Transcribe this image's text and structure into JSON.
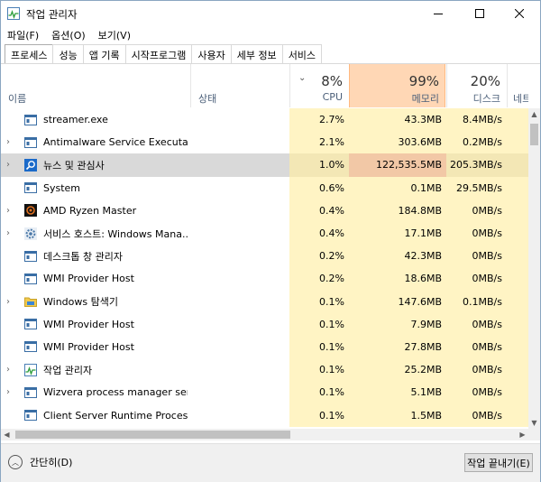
{
  "window": {
    "title": "작업 관리자"
  },
  "menu": [
    "파일(F)",
    "옵션(O)",
    "보기(V)"
  ],
  "tabs": [
    "프로세스",
    "성능",
    "앱 기록",
    "시작프로그램",
    "사용자",
    "세부 정보",
    "서비스"
  ],
  "columns": {
    "name": {
      "label": "이름"
    },
    "status": {
      "label": "상태"
    },
    "cpu": {
      "pct": "8%",
      "label": "CPU"
    },
    "memory": {
      "pct": "99%",
      "label": "메모리"
    },
    "disk": {
      "pct": "20%",
      "label": "디스크"
    },
    "network": {
      "label": "네트"
    }
  },
  "processes": [
    {
      "name": "streamer.exe",
      "cpu": "2.7%",
      "mem": "43.3MB",
      "disk": "8.4MB/s",
      "expandable": false,
      "icon": "window-icon"
    },
    {
      "name": "Antimalware Service Executable",
      "cpu": "2.1%",
      "mem": "303.6MB",
      "disk": "0.2MB/s",
      "expandable": true,
      "icon": "window-icon"
    },
    {
      "name": "뉴스 및 관심사",
      "cpu": "1.0%",
      "mem": "122,535.5MB",
      "disk": "205.3MB/s",
      "expandable": true,
      "icon": "search-icon",
      "selected": true
    },
    {
      "name": "System",
      "cpu": "0.6%",
      "mem": "0.1MB",
      "disk": "29.5MB/s",
      "expandable": false,
      "icon": "window-icon"
    },
    {
      "name": "AMD Ryzen Master",
      "cpu": "0.4%",
      "mem": "184.8MB",
      "disk": "0MB/s",
      "expandable": true,
      "icon": "amd-icon"
    },
    {
      "name": "서비스 호스트: Windows Mana...",
      "cpu": "0.4%",
      "mem": "17.1MB",
      "disk": "0MB/s",
      "expandable": true,
      "icon": "gear-icon"
    },
    {
      "name": "데스크톱 창 관리자",
      "cpu": "0.2%",
      "mem": "42.3MB",
      "disk": "0MB/s",
      "expandable": false,
      "icon": "window-icon"
    },
    {
      "name": "WMI Provider Host",
      "cpu": "0.2%",
      "mem": "18.6MB",
      "disk": "0MB/s",
      "expandable": false,
      "icon": "window-icon"
    },
    {
      "name": "Windows 탐색기",
      "cpu": "0.1%",
      "mem": "147.6MB",
      "disk": "0.1MB/s",
      "expandable": true,
      "icon": "folder-icon"
    },
    {
      "name": "WMI Provider Host",
      "cpu": "0.1%",
      "mem": "7.9MB",
      "disk": "0MB/s",
      "expandable": false,
      "icon": "window-icon"
    },
    {
      "name": "WMI Provider Host",
      "cpu": "0.1%",
      "mem": "27.8MB",
      "disk": "0MB/s",
      "expandable": false,
      "icon": "window-icon"
    },
    {
      "name": "작업 관리자",
      "cpu": "0.1%",
      "mem": "25.2MB",
      "disk": "0MB/s",
      "expandable": true,
      "icon": "taskmgr-icon"
    },
    {
      "name": "Wizvera process manager servi...",
      "cpu": "0.1%",
      "mem": "5.1MB",
      "disk": "0MB/s",
      "expandable": true,
      "icon": "window-icon"
    },
    {
      "name": "Client Server Runtime Process",
      "cpu": "0.1%",
      "mem": "1.5MB",
      "disk": "0MB/s",
      "expandable": false,
      "icon": "window-icon"
    }
  ],
  "footer": {
    "fewer_details": "간단히(D)",
    "end_task": "작업 끝내기(E)"
  },
  "colors": {
    "heat_light": "#fff4c4",
    "heat_memory_header": "#ffd7b5",
    "selection": "#d9d9d9"
  }
}
